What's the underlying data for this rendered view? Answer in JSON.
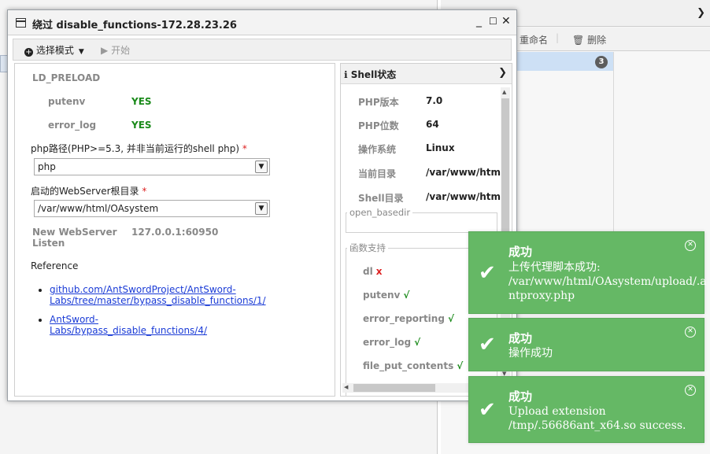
{
  "background": {
    "toolbar": {
      "rename_label": "重命名",
      "delete_label": "删除"
    },
    "badge_count": "3"
  },
  "dialog": {
    "title": "绕过 disable_functions-172.28.23.26",
    "toolbar": {
      "mode_label": "选择模式",
      "start_label": "开始"
    },
    "form": {
      "mode_name": "LD_PRELOAD",
      "checks": [
        {
          "key": "putenv",
          "value": "YES"
        },
        {
          "key": "error_log",
          "value": "YES"
        }
      ],
      "php_path_label": "php路径(PHP>=5.3, 并非当前运行的shell php)",
      "php_path_value": "php",
      "webroot_label": "启动的WebServer根目录",
      "webroot_value": "/var/www/html/OAsystem",
      "listen_label": "New WebServer Listen",
      "listen_value": "127.0.0.1:60950",
      "reference_label": "Reference",
      "references": [
        "github.com/AntSwordProject/AntSword-Labs/tree/master/bypass_disable_functions/1/",
        "AntSword-Labs/bypass_disable_functions/4/"
      ]
    },
    "shell_status": {
      "title": "Shell状态",
      "rows": [
        {
          "key": "PHP版本",
          "value": "7.0"
        },
        {
          "key": "PHP位数",
          "value": "64"
        },
        {
          "key": "操作系统",
          "value": "Linux"
        },
        {
          "key": "当前目录",
          "value": "/var/www/html"
        },
        {
          "key": "Shell目录",
          "value": "/var/www/html"
        }
      ],
      "open_basedir_label": "open_basedir",
      "functions_label": "函数支持",
      "functions": [
        {
          "name": "dl",
          "supported": false,
          "mark": "x"
        },
        {
          "name": "putenv",
          "supported": true,
          "mark": "√"
        },
        {
          "name": "error_reporting",
          "supported": true,
          "mark": "√"
        },
        {
          "name": "error_log",
          "supported": true,
          "mark": "√"
        },
        {
          "name": "file_put_contents",
          "supported": true,
          "mark": "√"
        }
      ]
    }
  },
  "toasts": [
    {
      "title": "成功",
      "message": "上传代理脚本成功:\n/var/www/html/OAsystem/upload/.a\nntproxy.php"
    },
    {
      "title": "成功",
      "message": "操作成功"
    },
    {
      "title": "成功",
      "message": "Upload extension\n/tmp/.56686ant_x64.so success."
    }
  ],
  "colors": {
    "success_green": "#65b865",
    "yes_green": "#1a8a1a",
    "required_red": "#dd2222",
    "link_blue": "#1a3bd6"
  }
}
